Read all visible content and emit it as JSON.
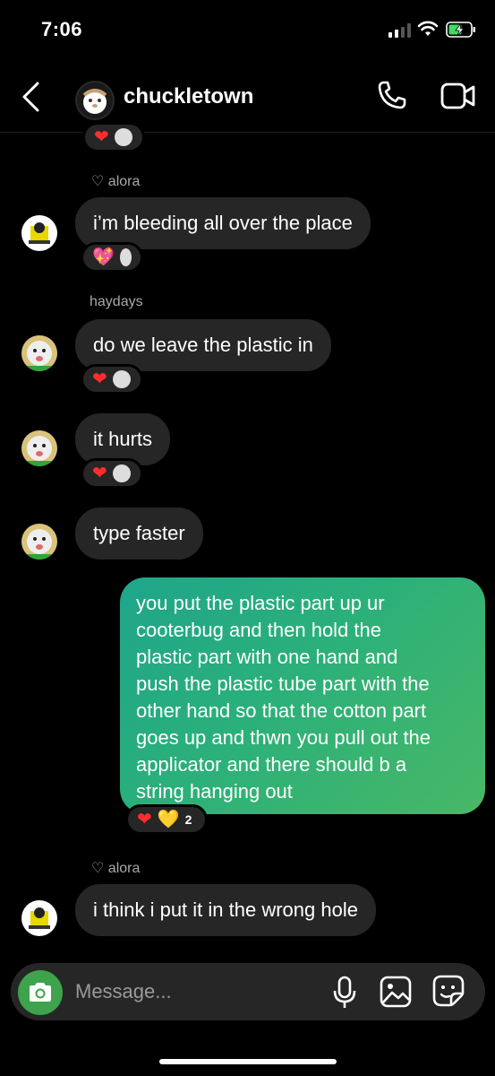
{
  "status": {
    "time": "7:06"
  },
  "header": {
    "title": "chuckletown"
  },
  "messages": [
    {
      "sender": "alora",
      "text": "i’m bleeding all over the place"
    },
    {
      "sender": "haydays",
      "text": "do we leave the plastic in"
    },
    {
      "text": "it hurts"
    },
    {
      "text": "type faster"
    },
    {
      "text": "you put the plastic part up ur\ncooterbug and then hold the\nplastic part with one hand and\npush the plastic tube part with the\nother hand so that the cotton part\ngoes up and thwn you pull out the\napplicator and there should b a\nstring hanging out",
      "reaction_count": "2"
    },
    {
      "sender": "alora",
      "text": "i think i put it in the wrong hole"
    }
  ],
  "composer": {
    "placeholder": "Message..."
  },
  "colors": {
    "sent_gradient_start": "#1fa58a",
    "sent_gradient_end": "#48b866",
    "camera": "#3ea34c"
  }
}
